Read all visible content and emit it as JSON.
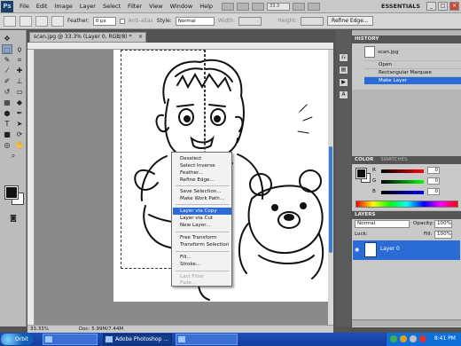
{
  "menubar": {
    "logo": "Ps",
    "items": [
      "File",
      "Edit",
      "Image",
      "Layer",
      "Select",
      "Filter",
      "View",
      "Window",
      "Help"
    ],
    "zoom": "33.3",
    "workspace": "ESSENTIALS"
  },
  "options": {
    "feather_label": "Feather:",
    "feather_value": "0 px",
    "antialias_label": "Anti-alias",
    "style_label": "Style:",
    "style_value": "Normal",
    "width_label": "Width:",
    "height_label": "Height:",
    "refine_label": "Refine Edge..."
  },
  "document": {
    "tab_title": "scan.jpg @ 33.3% (Layer 0, RGB/8) *",
    "zoom": "33.33%",
    "doc_info": "Doc: 5.99M/7.44M"
  },
  "context_menu": {
    "items": [
      {
        "label": "Deselect",
        "state": "normal"
      },
      {
        "label": "Select Inverse",
        "state": "normal"
      },
      {
        "label": "Feather...",
        "state": "normal"
      },
      {
        "label": "Refine Edge...",
        "state": "normal"
      },
      {
        "label": "Save Selection...",
        "state": "normal"
      },
      {
        "label": "Make Work Path...",
        "state": "normal"
      },
      {
        "label": "Layer via Copy",
        "state": "selected"
      },
      {
        "label": "Layer via Cut",
        "state": "normal"
      },
      {
        "label": "New Layer...",
        "state": "normal"
      },
      {
        "label": "Free Transform",
        "state": "normal"
      },
      {
        "label": "Transform Selection",
        "state": "normal"
      },
      {
        "label": "Fill...",
        "state": "normal"
      },
      {
        "label": "Stroke...",
        "state": "normal"
      },
      {
        "label": "Last Filter",
        "state": "disabled"
      },
      {
        "label": "Fade...",
        "state": "disabled"
      }
    ]
  },
  "history": {
    "title": "HISTORY",
    "snapshot": "scan.jpg",
    "items": [
      {
        "label": "Open",
        "selected": false
      },
      {
        "label": "Rectangular Marquee",
        "selected": false
      },
      {
        "label": "Make Layer",
        "selected": true
      }
    ]
  },
  "color": {
    "title": "COLOR",
    "swatches_title": "SWATCHES",
    "sliders": [
      {
        "label": "R",
        "value": "0"
      },
      {
        "label": "G",
        "value": "0"
      },
      {
        "label": "B",
        "value": "0"
      }
    ]
  },
  "layers": {
    "title": "LAYERS",
    "blend_mode": "Normal",
    "opacity_label": "Opacity:",
    "opacity_value": "100%",
    "lock_label": "Lock:",
    "fill_label": "Fill:",
    "fill_value": "100%",
    "layer_name": "Layer 0"
  },
  "taskbar": {
    "start": "Orbit",
    "tasks": [
      "Adobe Photoshop ...",
      ""
    ],
    "clock": "8:41 PM"
  },
  "colors": {
    "selection_blue": "#2b6bd6",
    "ui_gray": "#c9c9c9",
    "taskbar_blue": "#1f4fbf"
  }
}
